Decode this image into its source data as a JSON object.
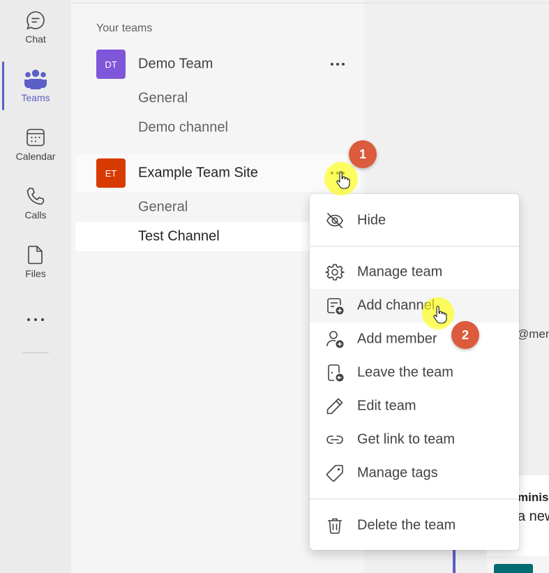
{
  "app_rail": {
    "items": [
      {
        "label": "Chat",
        "icon": "chat-icon"
      },
      {
        "label": "Teams",
        "icon": "teams-icon"
      },
      {
        "label": "Calendar",
        "icon": "calendar-icon"
      },
      {
        "label": "Calls",
        "icon": "calls-icon"
      },
      {
        "label": "Files",
        "icon": "files-icon"
      }
    ],
    "active": "Teams",
    "more_icon": "more-apps-icon"
  },
  "teams_panel": {
    "section_label": "Your teams",
    "teams": [
      {
        "initials": "DT",
        "name": "Demo Team",
        "avatar_color": "#7f56d9",
        "channels": [
          "General",
          "Demo channel"
        ]
      },
      {
        "initials": "ET",
        "name": "Example Team Site",
        "avatar_color": "#d83b01",
        "channels": [
          "General",
          "Test Channel"
        ],
        "selected_channel": "Test Channel"
      }
    ]
  },
  "context_menu": {
    "items": [
      {
        "label": "Hide",
        "icon": "hide-icon"
      },
      {
        "label": "Manage team",
        "icon": "gear-icon"
      },
      {
        "label": "Add channel",
        "icon": "add-channel-icon"
      },
      {
        "label": "Add member",
        "icon": "add-member-icon"
      },
      {
        "label": "Leave the team",
        "icon": "leave-team-icon"
      },
      {
        "label": "Edit team",
        "icon": "pencil-icon"
      },
      {
        "label": "Get link to team",
        "icon": "link-icon"
      },
      {
        "label": "Manage tags",
        "icon": "tag-icon"
      },
      {
        "label": "Delete the team",
        "icon": "trash-icon"
      }
    ],
    "hovered": "Add channel"
  },
  "content": {
    "mention_fragment": "@men",
    "message_author_fragment": "minis",
    "message_body_fragment": "a new"
  },
  "annotations": {
    "steps": [
      "1",
      "2"
    ]
  },
  "colors": {
    "accent": "#5b5fc7",
    "badge": "#dc5b3c",
    "highlight": "#ffff00"
  }
}
